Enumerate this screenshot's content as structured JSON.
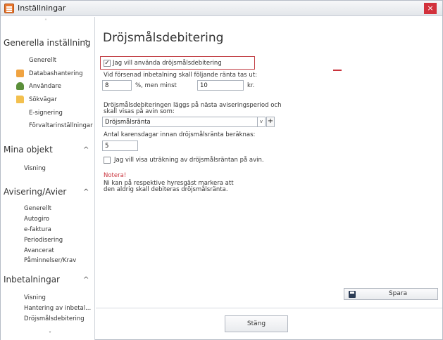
{
  "window": {
    "title": "Inställningar",
    "close_glyph": "×"
  },
  "sidebar": {
    "scroll_up": "˄",
    "scroll_down": "˅",
    "sections": [
      {
        "title": "Generella inställning",
        "chevron": "^",
        "items": [
          "Generellt",
          "Databashantering",
          "Användare",
          "Sökvägar",
          "E-signering",
          "Förvaltarinställningar"
        ]
      },
      {
        "title": "Mina objekt",
        "chevron": "^",
        "items": [
          "Visning"
        ]
      },
      {
        "title": "Avisering/Avier",
        "chevron": "^",
        "items": [
          "Generellt",
          "Autogiro",
          "e-faktura",
          "Periodisering",
          "Avancerat",
          "Påminnelser/Krav"
        ]
      },
      {
        "title": "Inbetalningar",
        "chevron": "^",
        "items": [
          "Visning",
          "Hantering av inbetal...",
          "Dröjsmålsdebitering"
        ]
      }
    ],
    "icons": {
      "databashantering": "database-icon",
      "anvandare": "user-icon",
      "sokvagar": "folder-icon"
    }
  },
  "main": {
    "title": "Dröjsmålsdebitering",
    "use_checkbox": {
      "checked": true,
      "check_glyph": "✓",
      "label": "Jag vill använda dröjsmålsdebitering"
    },
    "rate_prompt": "Vid försenad inbetalning skall följande ränta tas ut:",
    "rate_value": "8",
    "rate_suffix": "%, men minst",
    "min_value": "10",
    "min_suffix": "kr.",
    "period_text_1": "Dröjsmålsdebiteringen läggs på nästa aviseringsperiod och",
    "period_text_2": "skall visas på avin som:",
    "display_select": "Dröjsmålsränta",
    "select_arrow": "v",
    "plus_label": "+",
    "grace_label": "Antal karensdagar innan dröjsmålsränta beräknas:",
    "grace_value": "5",
    "show_calc_checkbox": {
      "checked": false,
      "label": "Jag vill visa uträkning av dröjsmålsräntan på avin."
    },
    "note_title": "Notera!",
    "note_line_1": "Ni kan på respektive hyresgäst markera att",
    "note_line_2": "den aldrig skall debiteras dröjsmålsränta.",
    "save_label": "Spara",
    "close_label": "Stäng"
  },
  "colors": {
    "accent_red": "#c9323b",
    "close_red": "#d2313c",
    "border": "#aab1bb"
  }
}
